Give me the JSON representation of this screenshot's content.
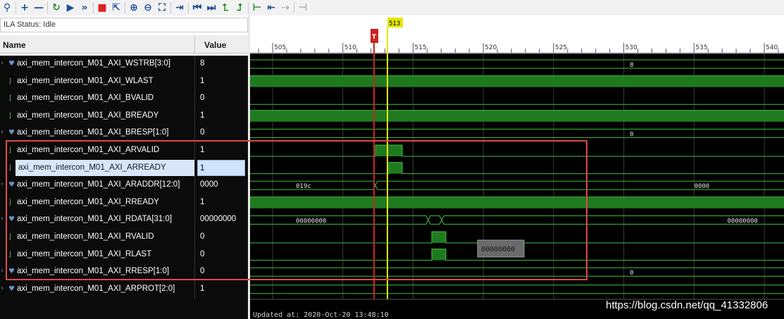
{
  "toolbar": {
    "buttons": [
      {
        "icon": "zoom-icon",
        "glyph": "⚲"
      },
      {
        "icon": "add-icon",
        "glyph": "+"
      },
      {
        "icon": "remove-icon",
        "glyph": "—"
      },
      {
        "icon": "run-trigger-icon",
        "glyph": "↻"
      },
      {
        "icon": "play-icon",
        "glyph": "▶"
      },
      {
        "icon": "fast-forward-icon",
        "glyph": "»"
      },
      {
        "icon": "stop-icon",
        "glyph": "■"
      },
      {
        "icon": "export-icon",
        "glyph": "⇱"
      },
      {
        "icon": "zoom-in-icon",
        "glyph": "⊕"
      },
      {
        "icon": "zoom-out-icon",
        "glyph": "⊖"
      },
      {
        "icon": "zoom-fit-icon",
        "glyph": "⛶"
      },
      {
        "icon": "goto-cursor-icon",
        "glyph": "⇥"
      },
      {
        "icon": "goto-start-icon",
        "glyph": "⏮"
      },
      {
        "icon": "goto-end-icon",
        "glyph": "⏭"
      },
      {
        "icon": "prev-transition-icon",
        "glyph": "⮤"
      },
      {
        "icon": "next-transition-icon",
        "glyph": "⮥"
      },
      {
        "icon": "add-marker-icon",
        "glyph": "⊢"
      },
      {
        "icon": "prev-marker-icon",
        "glyph": "⇤"
      },
      {
        "icon": "next-marker-icon",
        "glyph": "⇢"
      },
      {
        "icon": "swap-cursors-icon",
        "glyph": "⊣"
      }
    ]
  },
  "status": "ILA Status: Idle",
  "header": {
    "name": "Name",
    "value": "Value"
  },
  "signals": [
    {
      "name": "axi_mem_intercon_M01_AXI_WSTRB[3:0]",
      "value": "8",
      "kind": "bus"
    },
    {
      "name": "axi_mem_intercon_M01_AXI_WLAST",
      "value": "1",
      "kind": "bit"
    },
    {
      "name": "axi_mem_intercon_M01_AXI_BVALID",
      "value": "0",
      "kind": "bit"
    },
    {
      "name": "axi_mem_intercon_M01_AXI_BREADY",
      "value": "1",
      "kind": "bit"
    },
    {
      "name": "axi_mem_intercon_M01_AXI_BRESP[1:0]",
      "value": "0",
      "kind": "bus"
    },
    {
      "name": "axi_mem_intercon_M01_AXI_ARVALID",
      "value": "1",
      "kind": "bit"
    },
    {
      "name": "axi_mem_intercon_M01_AXI_ARREADY",
      "value": "1",
      "kind": "bit",
      "selected": true
    },
    {
      "name": "axi_mem_intercon_M01_AXI_ARADDR[12:0]",
      "value": "0000",
      "kind": "bus"
    },
    {
      "name": "axi_mem_intercon_M01_AXI_RREADY",
      "value": "1",
      "kind": "bit"
    },
    {
      "name": "axi_mem_intercon_M01_AXI_RDATA[31:0]",
      "value": "00000000",
      "kind": "bus"
    },
    {
      "name": "axi_mem_intercon_M01_AXI_RVALID",
      "value": "0",
      "kind": "bit"
    },
    {
      "name": "axi_mem_intercon_M01_AXI_RLAST",
      "value": "0",
      "kind": "bit"
    },
    {
      "name": "axi_mem_intercon_M01_AXI_RRESP[1:0]",
      "value": "0",
      "kind": "bus"
    },
    {
      "name": "axi_mem_intercon_M01_AXI_ARPROT[2:0]",
      "value": "1",
      "kind": "bus"
    }
  ],
  "timeline": {
    "ticks": [
      "505",
      "510",
      "515",
      "520",
      "525",
      "530",
      "535",
      "540"
    ],
    "cursor_label": "513",
    "trigger_label": "T",
    "bus_labels": {
      "wstrb": "8",
      "bresp": "0",
      "araddr_before": "019c",
      "araddr_after": "0000",
      "rdata_before": "00000000",
      "rdata_after": "00000000",
      "rresp": "0"
    },
    "tooltip": "00000000"
  },
  "updated": "Updated at: 2020-Oct-20 13:48:10",
  "watermark": "https://blog.csdn.net/qq_41332806",
  "colors": {
    "wave_green": "#1f7a1f",
    "wave_line": "#3fbf3f",
    "cursor": "#e6e600",
    "trigger": "#cc2222",
    "highlight_box": "#e04848"
  }
}
